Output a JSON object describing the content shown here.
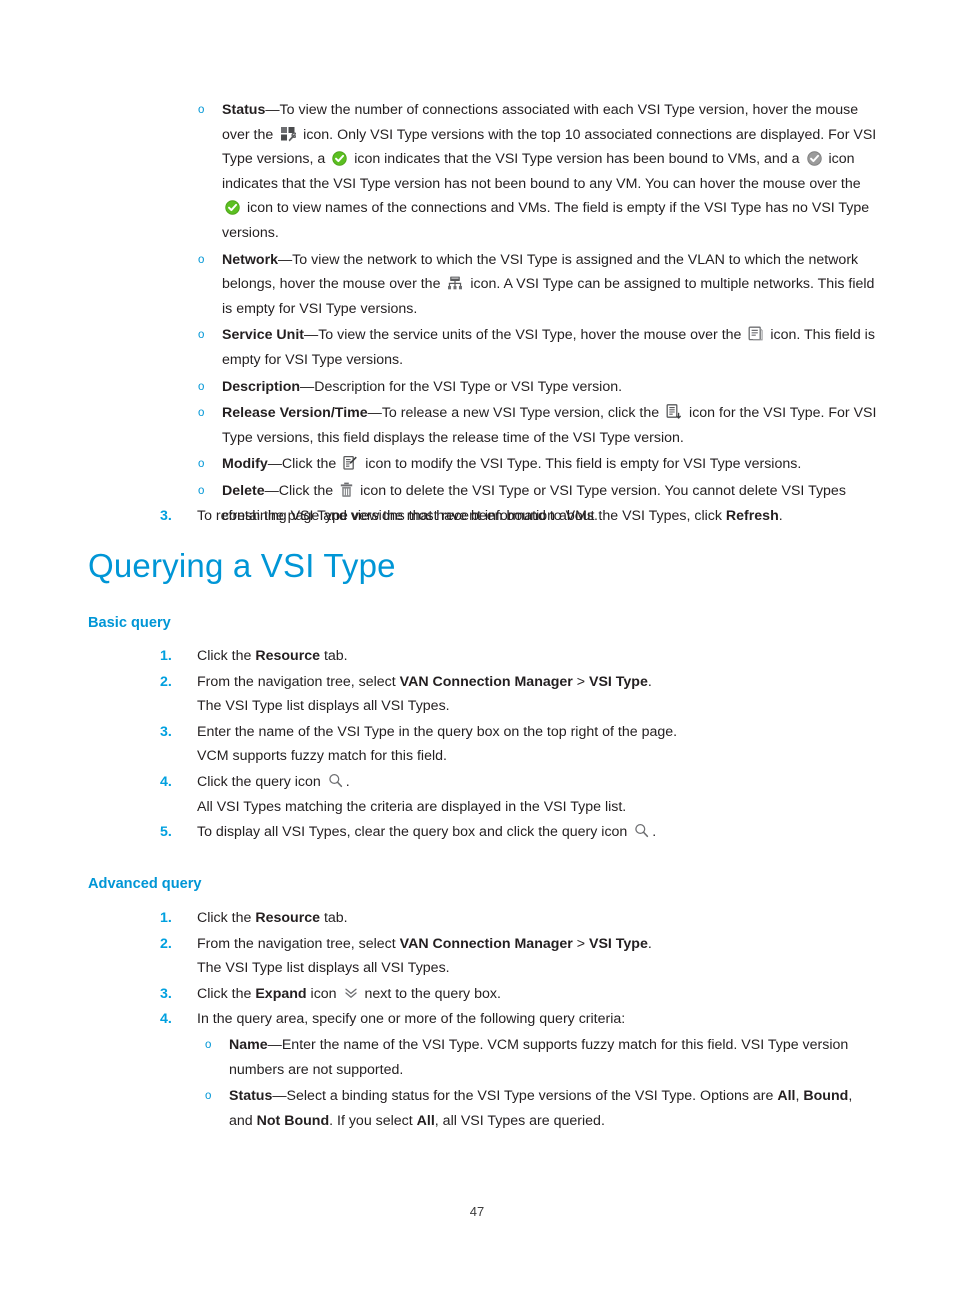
{
  "document": {
    "page_number": "47",
    "accent_color": "#0096d6",
    "number_color": "#00a0df",
    "bullet_color": "#0096d6",
    "text_color": "#231f20"
  },
  "top_bullets": {
    "marker": "o",
    "items": [
      {
        "term": "Status",
        "dash": "—",
        "segments": [
          {
            "type": "text",
            "value": "To view the number of connections associated with each VSI Type version, hover the mouse over the "
          },
          {
            "type": "icon",
            "name": "status-blocks-wrench-icon"
          },
          {
            "type": "text",
            "value": " icon. Only VSI Type versions with the top 10 associated connections are displayed. For VSI Type versions, a "
          },
          {
            "type": "icon",
            "name": "green-check-circle-icon"
          },
          {
            "type": "text",
            "value": " icon indicates that the VSI Type version has been bound to VMs, and a "
          },
          {
            "type": "icon",
            "name": "gray-check-circle-icon"
          },
          {
            "type": "text",
            "value": " icon indicates that the VSI Type version has not been bound to any VM. You can hover the mouse over the "
          },
          {
            "type": "icon",
            "name": "green-check-circle-icon"
          },
          {
            "type": "text",
            "value": " icon to view names of the connections and VMs. The field is empty if the VSI Type has no VSI Type versions."
          }
        ]
      },
      {
        "term": "Network",
        "dash": "—",
        "segments": [
          {
            "type": "text",
            "value": "To view the network to which the VSI Type is assigned and the VLAN to which the network belongs, hover the mouse over the "
          },
          {
            "type": "icon",
            "name": "network-hub-icon"
          },
          {
            "type": "text",
            "value": " icon. A VSI Type can be assigned to multiple networks. This field is empty for VSI Type versions."
          }
        ]
      },
      {
        "term": "Service Unit",
        "dash": "—",
        "segments": [
          {
            "type": "text",
            "value": "To view the service units of the VSI Type, hover the mouse over the "
          },
          {
            "type": "icon",
            "name": "service-unit-list-icon"
          },
          {
            "type": "text",
            "value": " icon. This field is empty for VSI Type versions."
          }
        ]
      },
      {
        "term": "Description",
        "dash": "—",
        "segments": [
          {
            "type": "text",
            "value": "Description for the VSI Type or VSI Type version."
          }
        ]
      },
      {
        "term": "Release Version/Time",
        "dash": "—",
        "segments": [
          {
            "type": "text",
            "value": "To release a new VSI Type version, click the "
          },
          {
            "type": "icon",
            "name": "release-version-icon"
          },
          {
            "type": "text",
            "value": " icon for the VSI Type. For VSI Type versions, this field displays the release time of the VSI Type version."
          }
        ]
      },
      {
        "term": "Modify",
        "dash": "—",
        "segments": [
          {
            "type": "text",
            "value": "Click the "
          },
          {
            "type": "icon",
            "name": "modify-pencil-icon"
          },
          {
            "type": "text",
            "value": " icon to modify the VSI Type. This field is empty for VSI Type versions."
          }
        ]
      },
      {
        "term": "Delete",
        "dash": "—",
        "segments": [
          {
            "type": "text",
            "value": "Click the "
          },
          {
            "type": "icon",
            "name": "delete-trash-icon"
          },
          {
            "type": "text",
            "value": " icon to delete the VSI Type or VSI Type version. You cannot delete VSI Types containing VSI Type versions that have been bound to VMs."
          }
        ]
      }
    ]
  },
  "step3": {
    "number": "3.",
    "segments": [
      {
        "type": "text",
        "value": "To refresh the page and view the most recent information about the VSI Types, click "
      },
      {
        "type": "bold",
        "value": "Refresh"
      },
      {
        "type": "text",
        "value": "."
      }
    ]
  },
  "chapter_title": "Querying a VSI Type",
  "basic_query": {
    "heading": "Basic query",
    "steps": [
      {
        "number": "1.",
        "segments": [
          {
            "type": "text",
            "value": "Click the "
          },
          {
            "type": "bold",
            "value": "Resource"
          },
          {
            "type": "text",
            "value": " tab."
          }
        ]
      },
      {
        "number": "2.",
        "segments": [
          {
            "type": "text",
            "value": "From the navigation tree, select "
          },
          {
            "type": "bold",
            "value": "VAN Connection Manager"
          },
          {
            "type": "text",
            "value": " > "
          },
          {
            "type": "bold",
            "value": "VSI Type"
          },
          {
            "type": "text",
            "value": "."
          }
        ],
        "continuation": "The VSI Type list displays all VSI Types."
      },
      {
        "number": "3.",
        "segments": [
          {
            "type": "text",
            "value": "Enter the name of the VSI Type in the query box on the top right of the page."
          }
        ],
        "continuation": "VCM supports fuzzy match for this field."
      },
      {
        "number": "4.",
        "segments": [
          {
            "type": "text",
            "value": "Click the query icon "
          },
          {
            "type": "icon",
            "name": "search-magnifier-icon"
          },
          {
            "type": "text",
            "value": "."
          }
        ],
        "continuation": "All VSI Types matching the criteria are displayed in the VSI Type list."
      },
      {
        "number": "5.",
        "segments": [
          {
            "type": "text",
            "value": "To display all VSI Types, clear the query box and click the query icon "
          },
          {
            "type": "icon",
            "name": "search-magnifier-icon"
          },
          {
            "type": "text",
            "value": "."
          }
        ]
      }
    ]
  },
  "advanced_query": {
    "heading": "Advanced query",
    "steps": [
      {
        "number": "1.",
        "segments": [
          {
            "type": "text",
            "value": "Click the "
          },
          {
            "type": "bold",
            "value": "Resource"
          },
          {
            "type": "text",
            "value": " tab."
          }
        ]
      },
      {
        "number": "2.",
        "segments": [
          {
            "type": "text",
            "value": "From the navigation tree, select "
          },
          {
            "type": "bold",
            "value": "VAN Connection Manager"
          },
          {
            "type": "text",
            "value": " > "
          },
          {
            "type": "bold",
            "value": "VSI Type"
          },
          {
            "type": "text",
            "value": "."
          }
        ],
        "continuation": "The VSI Type list displays all VSI Types."
      },
      {
        "number": "3.",
        "segments": [
          {
            "type": "text",
            "value": "Click the "
          },
          {
            "type": "bold",
            "value": "Expand"
          },
          {
            "type": "text",
            "value": " icon "
          },
          {
            "type": "icon",
            "name": "expand-chevron-down-icon"
          },
          {
            "type": "text",
            "value": " next to the query box."
          }
        ]
      },
      {
        "number": "4.",
        "segments": [
          {
            "type": "text",
            "value": "In the query area, specify one or more of the following query criteria:"
          }
        ],
        "sub_items": [
          {
            "term": "Name",
            "dash": "—",
            "segments": [
              {
                "type": "text",
                "value": "Enter the name of the VSI Type. VCM supports fuzzy match for this field. VSI Type version numbers are not supported."
              }
            ]
          },
          {
            "term": "Status",
            "dash": "—",
            "segments": [
              {
                "type": "text",
                "value": "Select a binding status for the VSI Type versions of the VSI Type. Options are "
              },
              {
                "type": "bold",
                "value": "All"
              },
              {
                "type": "text",
                "value": ", "
              },
              {
                "type": "bold",
                "value": "Bound"
              },
              {
                "type": "text",
                "value": ", and "
              },
              {
                "type": "bold",
                "value": "Not Bound"
              },
              {
                "type": "text",
                "value": ". If you select "
              },
              {
                "type": "bold",
                "value": "All"
              },
              {
                "type": "text",
                "value": ", all VSI Types are queried."
              }
            ]
          }
        ]
      }
    ]
  }
}
